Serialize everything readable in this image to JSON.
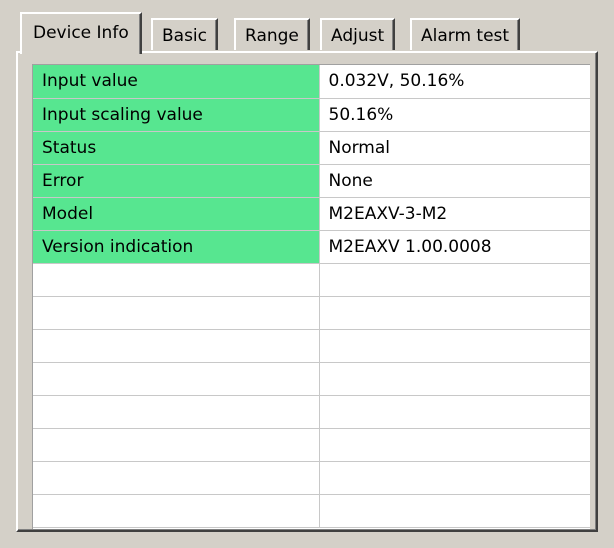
{
  "tabs": [
    {
      "label": "Device Info",
      "active": true
    },
    {
      "label": "Basic"
    },
    {
      "label": "Range"
    },
    {
      "label": "Adjust"
    },
    {
      "label": "Alarm test"
    }
  ],
  "rows": [
    {
      "label": "Input value",
      "value": "0.032V, 50.16%"
    },
    {
      "label": "Input scaling value",
      "value": "50.16%"
    },
    {
      "label": "Status",
      "value": "Normal"
    },
    {
      "label": "Error",
      "value": "None"
    },
    {
      "label": "Model",
      "value": "M2EAXV-3-M2"
    },
    {
      "label": "Version indication",
      "value": "M2EAXV 1.00.0008"
    },
    {
      "label": "",
      "value": ""
    },
    {
      "label": "",
      "value": ""
    },
    {
      "label": "",
      "value": ""
    },
    {
      "label": "",
      "value": ""
    },
    {
      "label": "",
      "value": ""
    },
    {
      "label": "",
      "value": ""
    },
    {
      "label": "",
      "value": ""
    },
    {
      "label": "",
      "value": ""
    }
  ],
  "colors": {
    "label_background": "#57e690",
    "window_background": "#d4d0c8"
  }
}
